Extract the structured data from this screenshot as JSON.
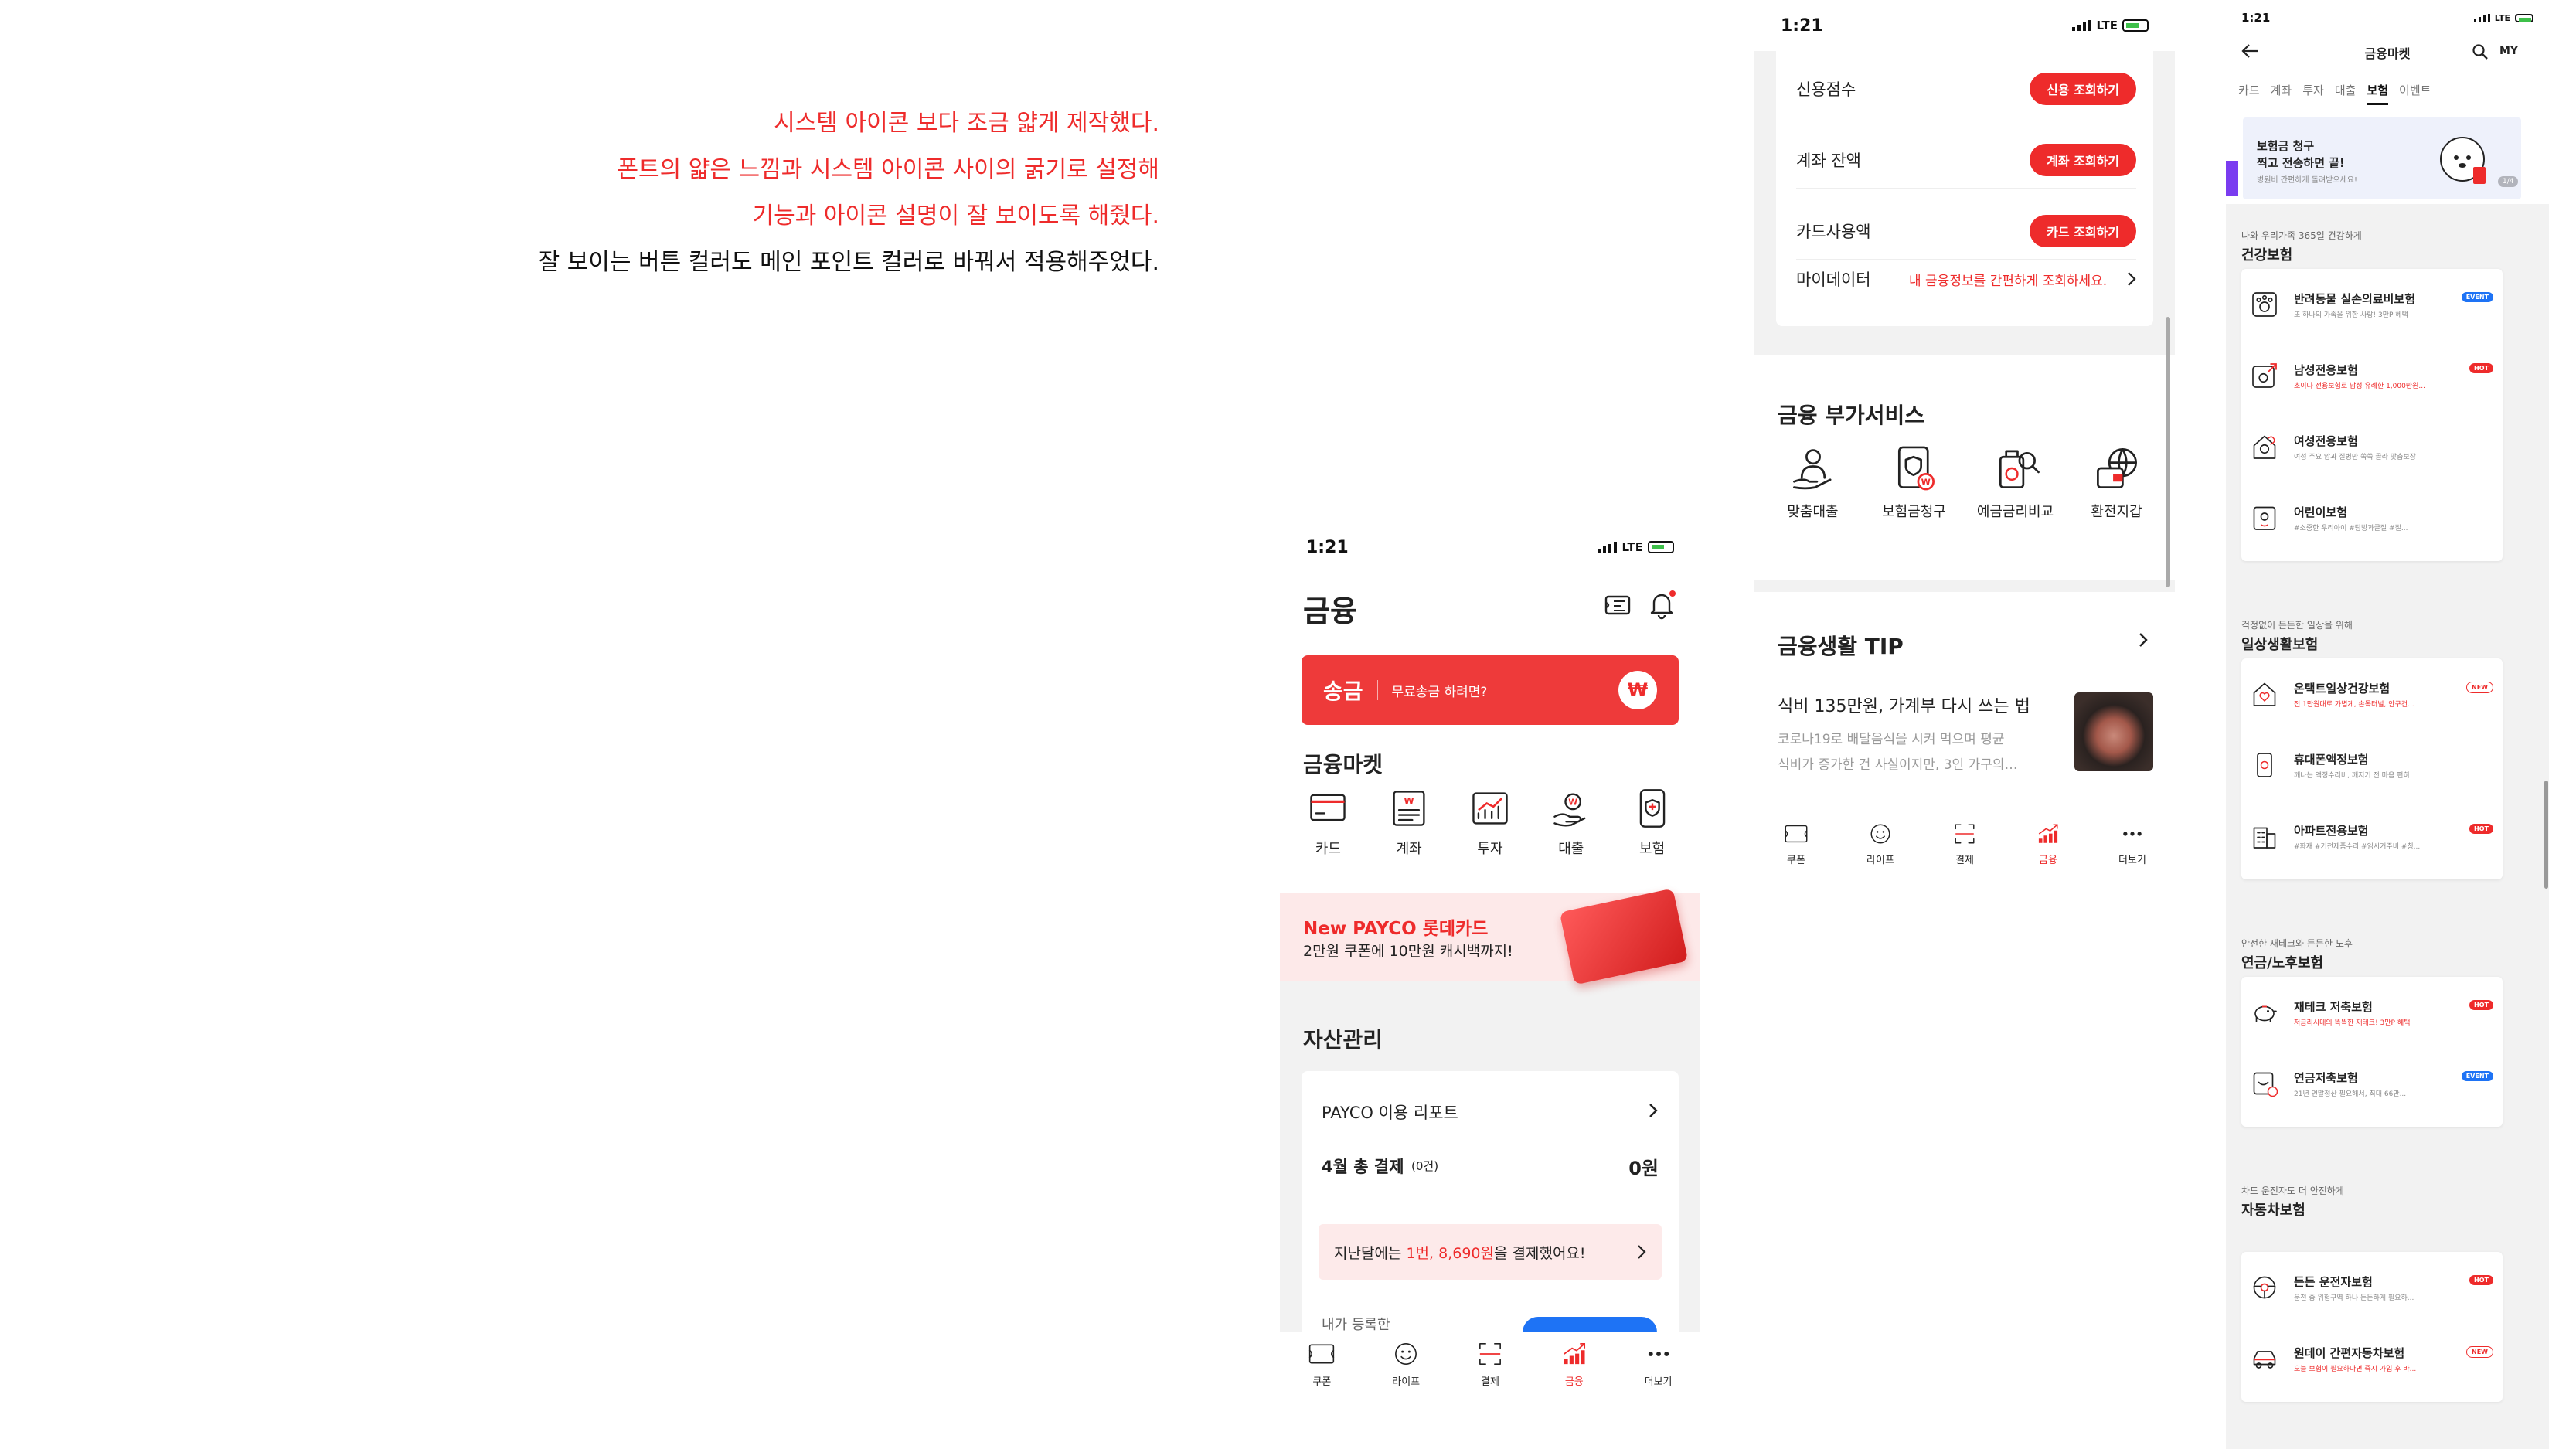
{
  "notes": {
    "line1": "시스템 아이콘 보다 조금 얇게 제작했다.",
    "line2": "폰트의 얇은 느낌과 시스템 아이콘 사이의 굵기로 설정해",
    "line3": "기능과 아이콘 설명이 잘 보이도록 해줬다.",
    "line4": "잘 보이는 버튼 컬러도 메인 포인트 컬러로 바꿔서 적용해주었다."
  },
  "colors": {
    "accent": "#ee2b2b",
    "blue": "#1e73f5"
  },
  "status": {
    "time": "1:21",
    "network": "LTE"
  },
  "screen1": {
    "title": "금융",
    "transfer": {
      "label": "송금",
      "sub": "무료송금 하려면?",
      "badge": "₩"
    },
    "market_title": "금융마켓",
    "market": [
      {
        "label": "카드",
        "icon": "card-icon"
      },
      {
        "label": "계좌",
        "icon": "account-icon"
      },
      {
        "label": "투자",
        "icon": "invest-icon"
      },
      {
        "label": "대출",
        "icon": "loan-icon"
      },
      {
        "label": "보험",
        "icon": "insurance-icon"
      }
    ],
    "banner": {
      "title": "New PAYCO 롯데카드",
      "sub": "2만원 쿠폰에 10만원 캐시백까지!"
    },
    "asset_title": "자산관리",
    "report": {
      "title": "PAYCO 이용 리포트",
      "month_label": "4월 총 결제",
      "count": "(0건)",
      "amount": "0원",
      "last_pre": "지난달에는 ",
      "last_hl": "1번, 8,690원",
      "last_post": "을 결제했어요!",
      "registered": "내가 등록한"
    }
  },
  "tabs": [
    {
      "label": "쿠폰",
      "icon": "coupon-icon"
    },
    {
      "label": "라이프",
      "icon": "life-icon"
    },
    {
      "label": "결제",
      "icon": "pay-scan-icon"
    },
    {
      "label": "금융",
      "icon": "finance-icon",
      "active": true
    },
    {
      "label": "더보기",
      "icon": "more-icon"
    }
  ],
  "screen2": {
    "rows": [
      {
        "label": "신용점수",
        "button": "신용 조회하기"
      },
      {
        "label": "계좌 잔액",
        "button": "계좌 조회하기"
      },
      {
        "label": "카드사용액",
        "button": "카드 조회하기"
      }
    ],
    "mydata": {
      "label": "마이데이터",
      "link": "내 금융정보를 간편하게 조회하세요."
    },
    "services_title": "금융 부가서비스",
    "services": [
      {
        "label": "맞춤대출",
        "icon": "custom-loan-icon"
      },
      {
        "label": "보험금청구",
        "icon": "insurance-claim-icon"
      },
      {
        "label": "예금금리비교",
        "icon": "rate-compare-icon"
      },
      {
        "label": "환전지갑",
        "icon": "exchange-wallet-icon"
      }
    ],
    "tip_title": "금융생활 TIP",
    "tip": {
      "headline": "식비 135만원, 가계부 다시 쓰는 법",
      "body1": "코로나19로 배달음식을 시켜 먹으며 평균",
      "body2": "식비가 증가한 건 사실이지만, 3인 가구의…"
    }
  },
  "screen3": {
    "title": "금융마켓",
    "my": "MY",
    "tabs": [
      "카드",
      "계좌",
      "투자",
      "대출",
      "보험",
      "이벤트"
    ],
    "active_tab": "보험",
    "promo": {
      "line1": "보험금 청구",
      "line2": "찍고 전송하면 끝!",
      "line3": "병원비 간편하게 돌려받으세요!",
      "page": "1/4"
    },
    "sections": [
      {
        "sub": "나와 우리가족 365일 건강하게",
        "title": "건강보험",
        "items": [
          {
            "name": "반려동물 실손의료비보험",
            "desc": "또 하나의 가족을 위한 사랑! 3만P 혜택",
            "badge": "EVENT",
            "badge_type": "blue",
            "desc_red": false,
            "icon": "pet-icon"
          },
          {
            "name": "남성전용보험",
            "desc": "초이나 전용보험로 남성 유례한 1,000만원...",
            "badge": "HOT",
            "badge_type": "red",
            "desc_red": true,
            "icon": "male-icon"
          },
          {
            "name": "여성전용보험",
            "desc": "여성 주요 암과 질병만 쏙쏙 골라 맞춤보장",
            "badge": "",
            "badge_type": "",
            "desc_red": false,
            "icon": "female-icon"
          },
          {
            "name": "어린이보험",
            "desc": "#소중한 우리아이 #탐방과골절 #질...",
            "badge": "",
            "badge_type": "",
            "desc_red": false,
            "icon": "child-icon"
          }
        ]
      },
      {
        "sub": "걱정없이 든든한 일상을 위해",
        "title": "일상생활보험",
        "items": [
          {
            "name": "온택트일상건강보험",
            "desc": "전 1만원대로 가볍게, 손목터널, 안구건...",
            "badge": "NEW",
            "badge_type": "outline",
            "desc_red": true,
            "icon": "home-heart-icon"
          },
          {
            "name": "휴대폰액정보험",
            "desc": "깨나는 액정수리비, 깨지기 전 마음 편히",
            "badge": "",
            "badge_type": "",
            "desc_red": false,
            "icon": "phone-icon"
          },
          {
            "name": "아파트전용보험",
            "desc": "#화재 #기전제품수리 #임시거주비 #칭...",
            "badge": "HOT",
            "badge_type": "red",
            "desc_red": false,
            "icon": "apartment-icon"
          }
        ]
      },
      {
        "sub": "안전한 재테크와 든든한 노후",
        "title": "연금/노후보험",
        "items": [
          {
            "name": "재테크 저축보험",
            "desc": "저금리시대의 똑똑한 재테크! 3만P 혜택",
            "badge": "HOT",
            "badge_type": "red",
            "desc_red": true,
            "icon": "piggy-icon"
          },
          {
            "name": "연금저축보험",
            "desc": "21년 연말정산 필요해서, 최대 66만...",
            "badge": "EVENT",
            "badge_type": "blue",
            "desc_red": false,
            "icon": "pension-icon"
          }
        ]
      },
      {
        "sub": "차도 운전자도 더 안전하게",
        "title": "자동차보험",
        "items": [
          {
            "name": "든든 운전자보험",
            "desc": "운전 중 위험구역 하나 든든하게 필요하...",
            "badge": "HOT",
            "badge_type": "red",
            "desc_red": false,
            "icon": "steering-icon"
          },
          {
            "name": "원데이 간편자동차보험",
            "desc": "오늘 보험이 필요하다면 즉시 가입 후 바...",
            "badge": "NEW",
            "badge_type": "outline",
            "desc_red": true,
            "icon": "car-icon"
          }
        ]
      }
    ]
  }
}
